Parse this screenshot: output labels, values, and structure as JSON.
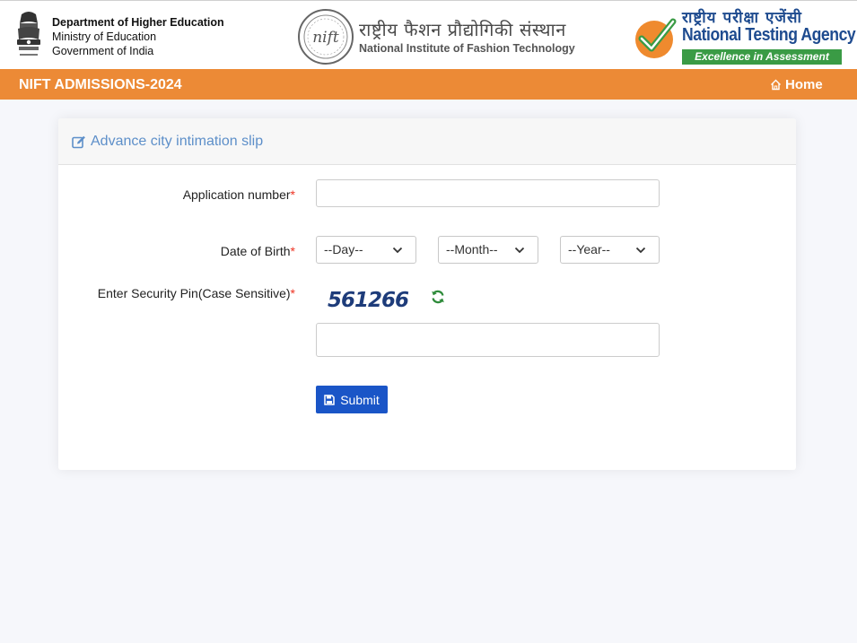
{
  "header": {
    "dept_line1": "Department of Higher Education",
    "dept_line2": "Ministry of Education",
    "dept_line3": "Government of India",
    "nift_hindi": "राष्ट्रीय फैशन प्रौद्योगिकी संस्थान",
    "nift_english": "National Institute of Fashion Technology",
    "nta_hindi": "राष्ट्रीय परीक्षा एजेंसी",
    "nta_english": "National Testing Agency",
    "nta_tagline": "Excellence in Assessment"
  },
  "navbar": {
    "title": "NIFT ADMISSIONS-2024",
    "home_label": "Home"
  },
  "form": {
    "title": "Advance city intimation slip",
    "application_label": "Application number",
    "application_value": "",
    "dob_label": "Date of Birth",
    "day_value": "--Day--",
    "month_value": "--Month--",
    "year_value": "--Year--",
    "security_label": "Enter Security Pin(Case Sensitive)",
    "captcha_text": "561266",
    "security_value": "",
    "required_mark": "*",
    "submit_label": "Submit"
  },
  "icons": {
    "home": "home-icon",
    "edit": "edit-icon",
    "refresh": "refresh-icon",
    "save": "save-icon",
    "chevron": "chevron-down-icon"
  },
  "colors": {
    "navbar": "#ec8a36",
    "card_title": "#5d8fc9",
    "submit": "#1a55c7",
    "required": "#ee3322",
    "refresh": "#2e8b3a",
    "nta_blue": "#1e4b8f",
    "nta_green": "#3a9b45"
  }
}
